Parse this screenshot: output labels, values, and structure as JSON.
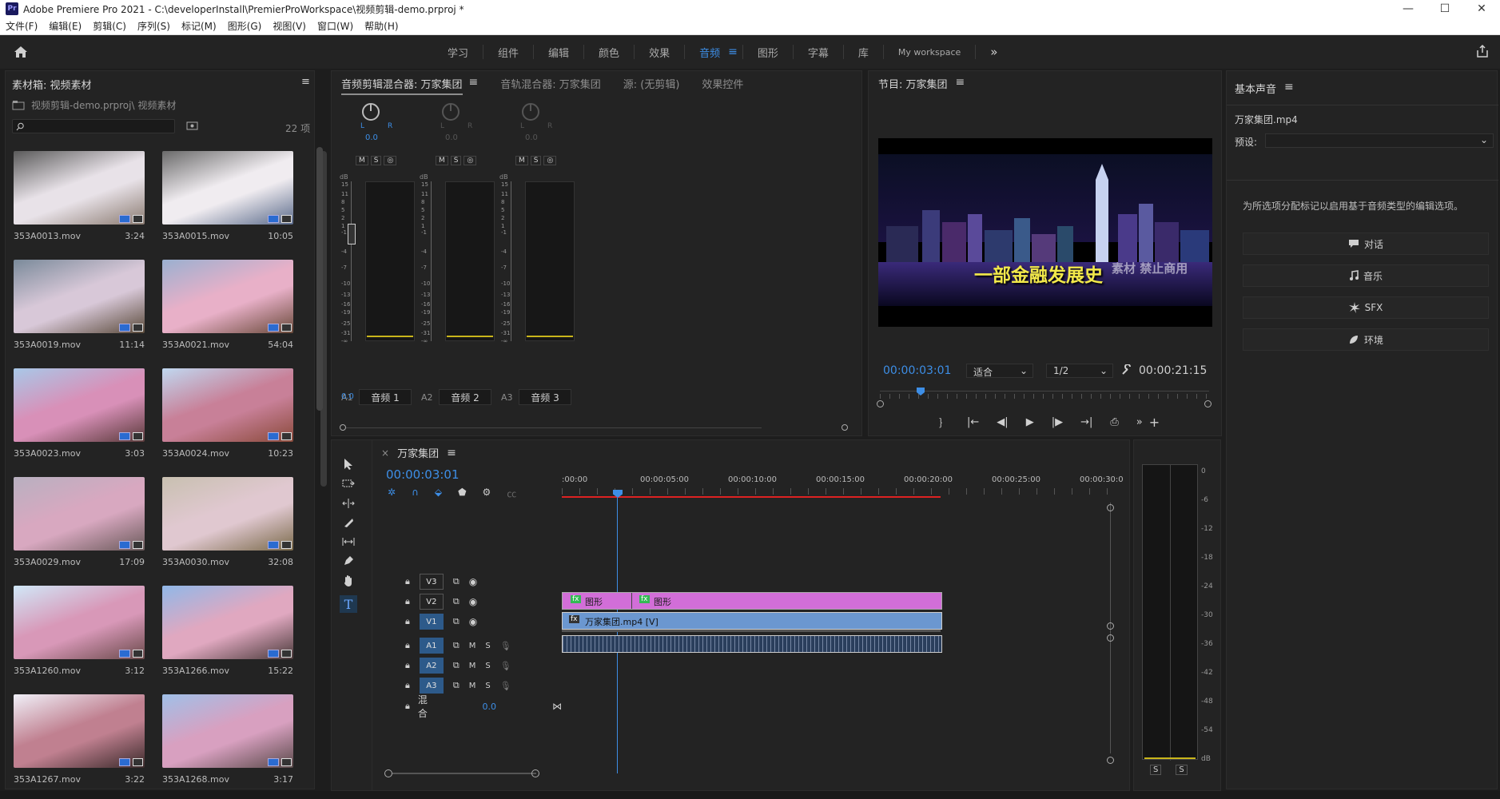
{
  "window": {
    "app_icon": "Pr",
    "title": "Adobe Premiere Pro 2021 - C:\\developerInstall\\PremierProWorkspace\\视频剪辑-demo.prproj *",
    "controls": [
      "—",
      "☐",
      "✕"
    ]
  },
  "menu": [
    "文件(F)",
    "编辑(E)",
    "剪辑(C)",
    "序列(S)",
    "标记(M)",
    "图形(G)",
    "视图(V)",
    "窗口(W)",
    "帮助(H)"
  ],
  "workspace": {
    "tabs": [
      "学习",
      "组件",
      "编辑",
      "颜色",
      "效果",
      "音频",
      "图形",
      "字幕",
      "库",
      "My workspace"
    ],
    "active": "音频",
    "more": "»",
    "menu_glyph": "≡"
  },
  "bin": {
    "title": "素材箱: 视频素材",
    "path": "视频剪辑-demo.prproj\\ 视频素材",
    "count": "22 项",
    "clips": [
      {
        "name": "353A0013.mov",
        "dur": "3:24"
      },
      {
        "name": "353A0015.mov",
        "dur": "10:05"
      },
      {
        "name": "353A0019.mov",
        "dur": "11:14"
      },
      {
        "name": "353A0021.mov",
        "dur": "54:04"
      },
      {
        "name": "353A0023.mov",
        "dur": "3:03"
      },
      {
        "name": "353A0024.mov",
        "dur": "10:23"
      },
      {
        "name": "353A0029.mov",
        "dur": "17:09"
      },
      {
        "name": "353A0030.mov",
        "dur": "32:08"
      },
      {
        "name": "353A1260.mov",
        "dur": "3:12"
      },
      {
        "name": "353A1266.mov",
        "dur": "15:22"
      },
      {
        "name": "353A1267.mov",
        "dur": "3:22"
      },
      {
        "name": "353A1268.mov",
        "dur": "3:17"
      }
    ]
  },
  "mixer": {
    "tabs": [
      "音频剪辑混合器: 万家集团",
      "音轨混合器: 万家集团",
      "源: (无剪辑)",
      "效果控件"
    ],
    "lr": "L",
    "rr": "R",
    "value": "0.0",
    "msb": [
      "M",
      "S",
      "◎"
    ],
    "db": "dB",
    "scale": [
      "15",
      "11",
      "8",
      "5",
      "2",
      "1",
      "-1",
      "-4",
      "-7",
      "-10",
      "-13",
      "-16",
      "-19",
      "-25",
      "-31",
      "-∞"
    ],
    "bottom_value": "0.0",
    "tracks": [
      {
        "id": "A1",
        "name": "音频 1"
      },
      {
        "id": "A2",
        "name": "音频 2"
      },
      {
        "id": "A3",
        "name": "音频 3"
      }
    ]
  },
  "program": {
    "title": "节目: 万家集团",
    "timecode": "00:00:03:01",
    "fit": "适合",
    "quality": "1/2",
    "duration": "00:00:21:15",
    "caption": "一部金融发展史",
    "watermark": "素材 禁止商用",
    "controls": [
      "｝",
      "|←",
      "◀|",
      "▶",
      "|▶",
      "→|",
      "⎙",
      "»",
      "+"
    ]
  },
  "basic_sound": {
    "title": "基本声音",
    "file": "万家集团.mp4",
    "preset_label": "预设:",
    "hint": "为所选项分配标记以启用基于音频类型的编辑选项。",
    "buttons": [
      {
        "label": "对话",
        "icon": "speech-bubble-icon"
      },
      {
        "label": "音乐",
        "icon": "music-note-icon"
      },
      {
        "label": "SFX",
        "icon": "burst-icon"
      },
      {
        "label": "环境",
        "icon": "ambience-icon"
      }
    ]
  },
  "timeline": {
    "title": "万家集团",
    "close": "×",
    "timecode": "00:00:03:01",
    "ruler": [
      ":00:00",
      "00:00:05:00",
      "00:00:10:00",
      "00:00:15:00",
      "00:00:20:00",
      "00:00:25:00",
      "00:00:30:0"
    ],
    "video_tracks": [
      "V3",
      "V2",
      "V1"
    ],
    "audio_tracks": [
      "A1",
      "A2",
      "A3"
    ],
    "ms": [
      "M",
      "S"
    ],
    "mix_label": "混合",
    "mix_value": "0.0",
    "clip_graphic": "图形",
    "clip_video": "万家集团.mp4 [V]",
    "fx": "fx"
  },
  "meter": {
    "scale": [
      "0",
      "-6",
      "-12",
      "-18",
      "-24",
      "-30",
      "-36",
      "-42",
      "-48",
      "-54",
      "dB"
    ],
    "solo": [
      "S",
      "S"
    ]
  }
}
